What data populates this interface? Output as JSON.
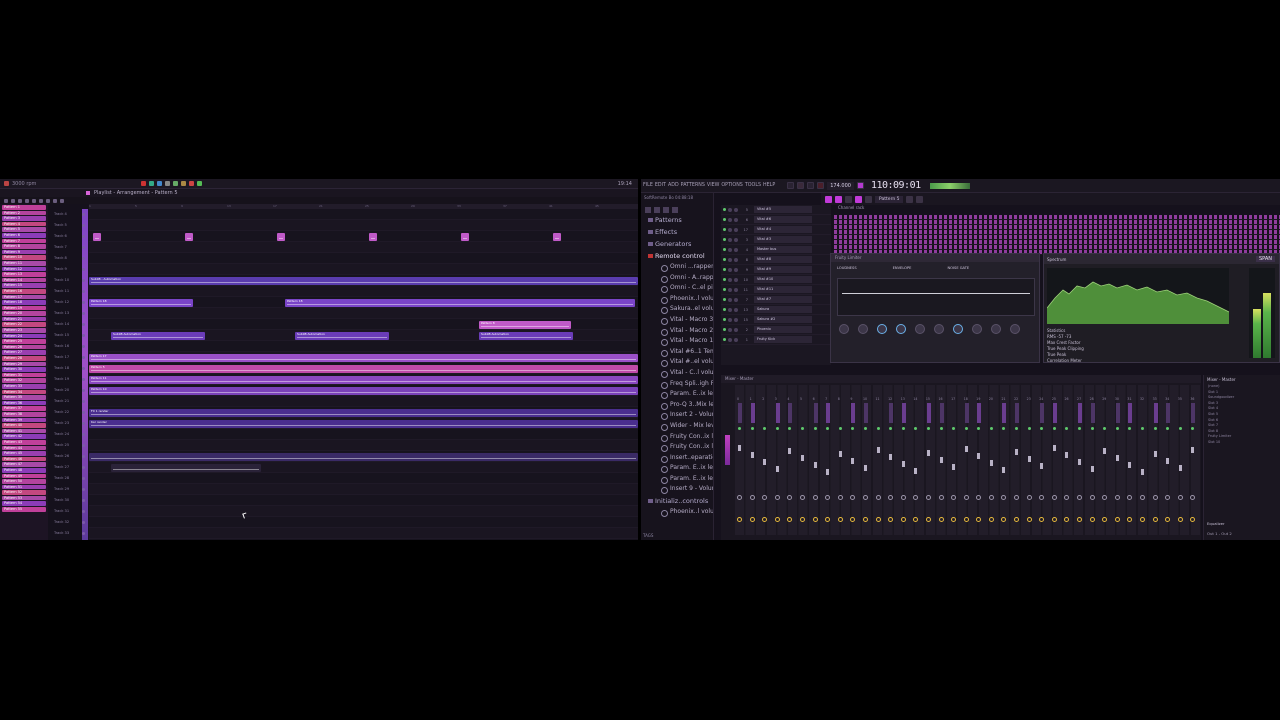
{
  "left": {
    "title": "Playlist - Arrangement - Pattern 5",
    "clock": "19:14",
    "tempo_status": "3000 rpm",
    "ruler": [
      "1",
      "5",
      "9",
      "13",
      "17",
      "21",
      "25",
      "29",
      "33",
      "37",
      "41",
      "45",
      "49"
    ],
    "pattern_list": [
      "Pattern 1",
      "Pattern 2",
      "Pattern 3",
      "Pattern 4",
      "Pattern 5",
      "Pattern 6",
      "Pattern 7",
      "Pattern 8",
      "Pattern 9",
      "Pattern 10",
      "Pattern 11",
      "Pattern 12",
      "Pattern 13",
      "Pattern 14",
      "Pattern 15",
      "Pattern 16",
      "Pattern 17",
      "Pattern 18",
      "Pattern 19",
      "Pattern 20",
      "Pattern 21",
      "Pattern 22",
      "Pattern 23",
      "Pattern 24",
      "Pattern 25",
      "Pattern 26",
      "Pattern 27",
      "Pattern 28",
      "Pattern 29",
      "Pattern 30",
      "Pattern 31",
      "Pattern 32",
      "Pattern 33",
      "Pattern 34",
      "Pattern 35",
      "Pattern 36",
      "Pattern 37",
      "Pattern 38",
      "Pattern 39",
      "Pattern 40",
      "Pattern 41",
      "Pattern 42",
      "Pattern 43",
      "Pattern 44",
      "Pattern 45",
      "Pattern 46",
      "Pattern 47",
      "Pattern 48",
      "Pattern 49",
      "Pattern 50",
      "Pattern 51",
      "Pattern 52",
      "Pattern 53",
      "Pattern 54",
      "Pattern 55"
    ],
    "tracks": [
      "Track 4",
      "Track 5",
      "Track 6",
      "Track 7",
      "Track 8",
      "Track 9",
      "Track 10",
      "Track 11",
      "Track 12",
      "Track 13",
      "Track 14",
      "Track 15",
      "Track 16",
      "Track 17",
      "Track 18",
      "Track 19",
      "Track 20",
      "Track 21",
      "Track 22",
      "Track 23",
      "Track 24",
      "Track 25",
      "Track 26",
      "Track 27",
      "Track 28",
      "Track 29",
      "Track 30",
      "Track 31",
      "Track 32",
      "Track 33"
    ],
    "clips": [
      {
        "lane": 2,
        "start": 4,
        "len": 8,
        "label": "",
        "color": "#c05ac8"
      },
      {
        "lane": 2,
        "start": 96,
        "len": 8,
        "label": "",
        "color": "#c05ac8"
      },
      {
        "lane": 2,
        "start": 188,
        "len": 8,
        "label": "",
        "color": "#c05ac8"
      },
      {
        "lane": 2,
        "start": 280,
        "len": 8,
        "label": "",
        "color": "#c05ac8"
      },
      {
        "lane": 2,
        "start": 372,
        "len": 8,
        "label": "",
        "color": "#c05ac8"
      },
      {
        "lane": 2,
        "start": 464,
        "len": 8,
        "label": "",
        "color": "#c05ac8"
      },
      {
        "lane": 6,
        "start": 0,
        "len": 549,
        "label": "Sub98 - Automation",
        "color": "#5a3cae"
      },
      {
        "lane": 8,
        "start": 0,
        "len": 104,
        "label": "Pattern 18",
        "color": "#7a44c8"
      },
      {
        "lane": 8,
        "start": 196,
        "len": 350,
        "label": "Pattern 18",
        "color": "#7a44c8"
      },
      {
        "lane": 10,
        "start": 390,
        "len": 92,
        "label": "Pattern 8",
        "color": "#c05ac8"
      },
      {
        "lane": 11,
        "start": 22,
        "len": 94,
        "label": "Sub98 Automation",
        "color": "#6a3cb8"
      },
      {
        "lane": 11,
        "start": 206,
        "len": 94,
        "label": "Sub98 Automation",
        "color": "#6a3cb8"
      },
      {
        "lane": 11,
        "start": 390,
        "len": 94,
        "label": "Sub98 Automation",
        "color": "#6a3cb8"
      },
      {
        "lane": 13,
        "start": 0,
        "len": 549,
        "label": "Pattern 17",
        "color": "#9a50c8"
      },
      {
        "lane": 14,
        "start": 0,
        "len": 549,
        "label": "Pattern 5",
        "color": "#c04aa8"
      },
      {
        "lane": 15,
        "start": 0,
        "len": 549,
        "label": "Pattern 11",
        "color": "#8a48c0"
      },
      {
        "lane": 16,
        "start": 0,
        "len": 549,
        "label": "Pattern 10",
        "color": "#7a42b8"
      },
      {
        "lane": 18,
        "start": 0,
        "len": 549,
        "label": "FX 1 render",
        "color": "#4a2e8e"
      },
      {
        "lane": 19,
        "start": 0,
        "len": 549,
        "label": "Kar render",
        "color": "#4a2e8e"
      },
      {
        "lane": 22,
        "start": 0,
        "len": 549,
        "label": "",
        "color": "#3a2a66"
      },
      {
        "lane": 23,
        "start": 22,
        "len": 150,
        "label": "",
        "color": "#2a2238"
      }
    ]
  },
  "right": {
    "menu": [
      "FILE",
      "EDIT",
      "ADD",
      "PATTERNS",
      "VIEW",
      "OPTIONS",
      "TOOLS",
      "HELP"
    ],
    "tempo": "174.000",
    "time": "110:09:01",
    "pattern": "Pattern 5",
    "browser": {
      "header": "SoftRemote Bo\n04:88:18",
      "folders": [
        "Patterns",
        "Effects",
        "Generators",
        "Remote control"
      ],
      "items": [
        "Omni ...rapper)",
        "Omni - A..rapper)",
        "Omni - C..el pitch",
        "Phoenix..l volume",
        "Sakura..el volume",
        "Vital - Macro 3",
        "Vital - Macro 2",
        "Vital - Macro 1",
        "Vital #6..1 Tempo",
        "Vital #..el volume",
        "Vital - C..l volume",
        "Freq Spli..igh Freq",
        "Param. E..ix level",
        "Pro-Q 3..Mix level",
        "Insert 2 - Volume",
        "Wider - Mix level",
        "Fruity Con..ix level",
        "Fruity Con..ix level",
        "Insert..eparation",
        "Param. E..ix level",
        "Param. E..ix level",
        "Insert 9 - Volume"
      ],
      "folder_after": "Initializ..controls",
      "last_item": "Phoenix..l volume",
      "tags": "TAGS"
    },
    "channels": [
      {
        "num": "5",
        "name": "Vital #5"
      },
      {
        "num": "6",
        "name": "Vital #6"
      },
      {
        "num": "17",
        "name": "Vital #4"
      },
      {
        "num": "3",
        "name": "Vital #3"
      },
      {
        "num": "4",
        "name": "Master bus"
      },
      {
        "num": "8",
        "name": "Vital #8"
      },
      {
        "num": "9",
        "name": "Vital #9"
      },
      {
        "num": "10",
        "name": "Vital #10"
      },
      {
        "num": "11",
        "name": "Vital #11"
      },
      {
        "num": "7",
        "name": "Vital #7"
      },
      {
        "num": "13",
        "name": "Sakura"
      },
      {
        "num": "15",
        "name": "Sakura #2"
      },
      {
        "num": "2",
        "name": "Phoenix"
      },
      {
        "num": "1",
        "name": "Fruity Kick"
      }
    ],
    "channel_rack_title": "Channel rack",
    "synth_title": "Fruity Limiter",
    "synth_labels": [
      "LOUDNESS",
      "ENVELOPE",
      "NOISE GATE"
    ],
    "span": {
      "title": "Spectrum",
      "brand": "SPAN",
      "stats": [
        "Statistics",
        "RMS -57 -73",
        "Max Crest Factor",
        "True Peak Clipping",
        "True Peak",
        "Correlation Meter"
      ],
      "meter_levels": [
        0.55,
        0.72
      ]
    },
    "mixer_title": "Mixer - Master",
    "mixer_count": 37,
    "mixer_fx": {
      "title": "Mixer - Master",
      "slots": [
        "(none)",
        "Slot 1",
        "Soundgoodizer",
        "Slot 3",
        "Slot 4",
        "Slot 5",
        "Slot 6",
        "Slot 7",
        "Slot 8",
        "Fruity Limiter",
        "Slot 10"
      ],
      "equalizer": "Equalizer",
      "out_none": "(none)",
      "out": "Out 1 - Out 2"
    }
  }
}
